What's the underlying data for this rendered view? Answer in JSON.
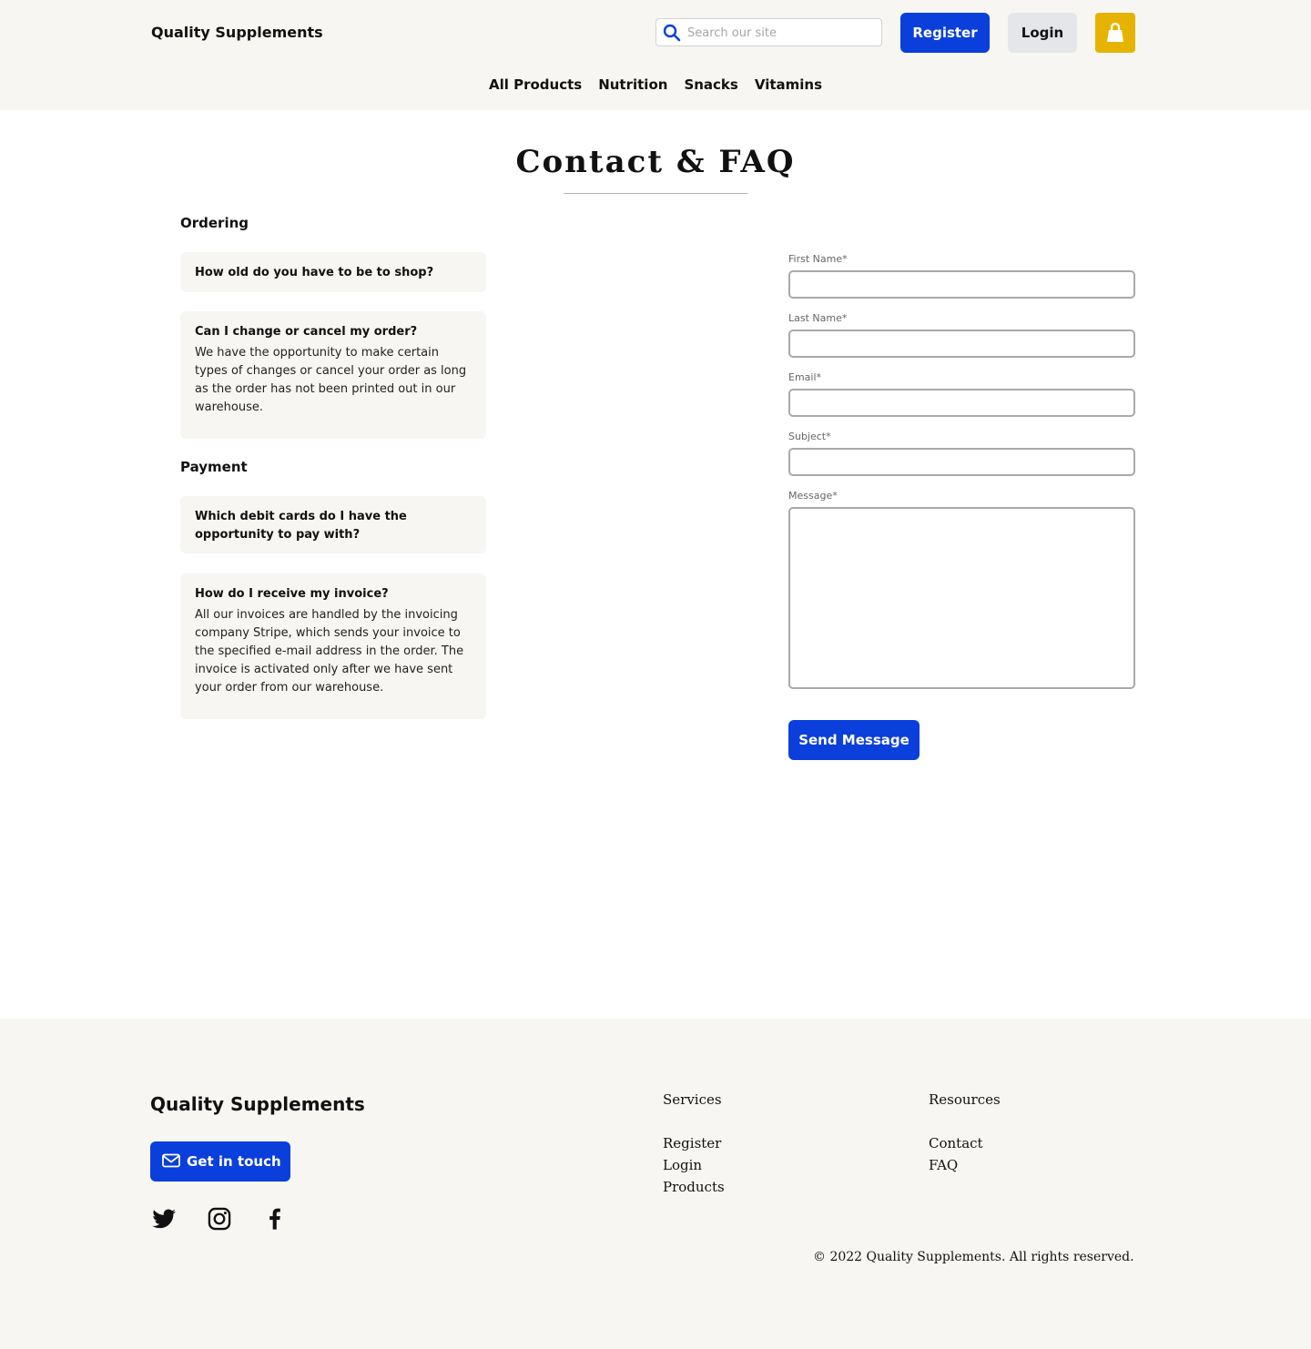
{
  "header": {
    "brand": "Quality Supplements",
    "search_placeholder": "Search our site",
    "register_label": "Register",
    "login_label": "Login",
    "cart_icon": "shopping-bag-icon",
    "accent_color": "#0a3fdc",
    "cart_color": "#e6b400"
  },
  "nav": {
    "items": [
      "All Products",
      "Nutrition",
      "Snacks",
      "Vitamins"
    ]
  },
  "main": {
    "title": "Contact & FAQ",
    "faq_sections": [
      {
        "heading": "Ordering",
        "items": [
          {
            "question": "How old do you have to be to shop?",
            "answer": ""
          },
          {
            "question": "Can I change or cancel my order?",
            "answer": "We have the opportunity to make certain types of changes or cancel your order as long as the order has not been printed out in our warehouse."
          }
        ]
      },
      {
        "heading": "Payment",
        "items": [
          {
            "question": "Which debit cards do I have the opportunity to pay with?",
            "answer": ""
          },
          {
            "question": "How do I receive my invoice?",
            "answer": "All our invoices are handled by the invoicing company Stripe, which sends your invoice to the specified e-mail address in the order. The invoice is activated only after we have sent your order from our warehouse."
          }
        ]
      }
    ],
    "form": {
      "first_name_label": "First Name*",
      "first_name_value": "",
      "last_name_label": "Last Name*",
      "last_name_value": "",
      "email_label": "Email*",
      "email_value": "",
      "subject_label": "Subject*",
      "subject_value": "",
      "message_label": "Message*",
      "message_value": "",
      "submit_label": "Send Message"
    }
  },
  "footer": {
    "brand": "Quality Supplements",
    "contact_label": "Get in touch",
    "social_icons": [
      "twitter-icon",
      "instagram-icon",
      "facebook-icon"
    ],
    "services": {
      "heading": "Services",
      "links": [
        "Register",
        "Login",
        "Products"
      ]
    },
    "resources": {
      "heading": "Resources",
      "links": [
        "Contact",
        "FAQ"
      ]
    },
    "copyright": "© 2022 Quality Supplements. All rights reserved."
  }
}
